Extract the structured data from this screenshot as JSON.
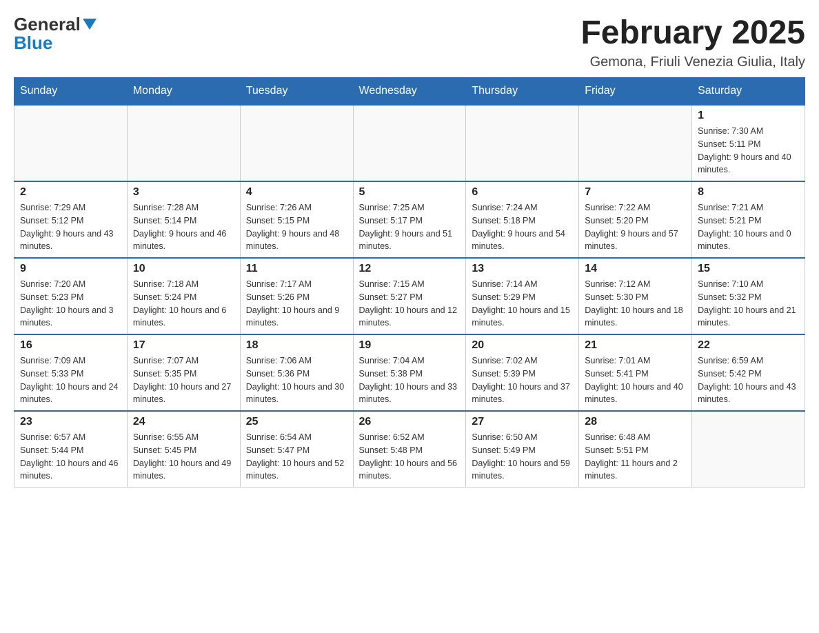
{
  "header": {
    "logo_general": "General",
    "logo_blue": "Blue",
    "title": "February 2025",
    "subtitle": "Gemona, Friuli Venezia Giulia, Italy"
  },
  "days_of_week": [
    "Sunday",
    "Monday",
    "Tuesday",
    "Wednesday",
    "Thursday",
    "Friday",
    "Saturday"
  ],
  "weeks": [
    [
      {
        "day": "",
        "info": ""
      },
      {
        "day": "",
        "info": ""
      },
      {
        "day": "",
        "info": ""
      },
      {
        "day": "",
        "info": ""
      },
      {
        "day": "",
        "info": ""
      },
      {
        "day": "",
        "info": ""
      },
      {
        "day": "1",
        "info": "Sunrise: 7:30 AM\nSunset: 5:11 PM\nDaylight: 9 hours and 40 minutes."
      }
    ],
    [
      {
        "day": "2",
        "info": "Sunrise: 7:29 AM\nSunset: 5:12 PM\nDaylight: 9 hours and 43 minutes."
      },
      {
        "day": "3",
        "info": "Sunrise: 7:28 AM\nSunset: 5:14 PM\nDaylight: 9 hours and 46 minutes."
      },
      {
        "day": "4",
        "info": "Sunrise: 7:26 AM\nSunset: 5:15 PM\nDaylight: 9 hours and 48 minutes."
      },
      {
        "day": "5",
        "info": "Sunrise: 7:25 AM\nSunset: 5:17 PM\nDaylight: 9 hours and 51 minutes."
      },
      {
        "day": "6",
        "info": "Sunrise: 7:24 AM\nSunset: 5:18 PM\nDaylight: 9 hours and 54 minutes."
      },
      {
        "day": "7",
        "info": "Sunrise: 7:22 AM\nSunset: 5:20 PM\nDaylight: 9 hours and 57 minutes."
      },
      {
        "day": "8",
        "info": "Sunrise: 7:21 AM\nSunset: 5:21 PM\nDaylight: 10 hours and 0 minutes."
      }
    ],
    [
      {
        "day": "9",
        "info": "Sunrise: 7:20 AM\nSunset: 5:23 PM\nDaylight: 10 hours and 3 minutes."
      },
      {
        "day": "10",
        "info": "Sunrise: 7:18 AM\nSunset: 5:24 PM\nDaylight: 10 hours and 6 minutes."
      },
      {
        "day": "11",
        "info": "Sunrise: 7:17 AM\nSunset: 5:26 PM\nDaylight: 10 hours and 9 minutes."
      },
      {
        "day": "12",
        "info": "Sunrise: 7:15 AM\nSunset: 5:27 PM\nDaylight: 10 hours and 12 minutes."
      },
      {
        "day": "13",
        "info": "Sunrise: 7:14 AM\nSunset: 5:29 PM\nDaylight: 10 hours and 15 minutes."
      },
      {
        "day": "14",
        "info": "Sunrise: 7:12 AM\nSunset: 5:30 PM\nDaylight: 10 hours and 18 minutes."
      },
      {
        "day": "15",
        "info": "Sunrise: 7:10 AM\nSunset: 5:32 PM\nDaylight: 10 hours and 21 minutes."
      }
    ],
    [
      {
        "day": "16",
        "info": "Sunrise: 7:09 AM\nSunset: 5:33 PM\nDaylight: 10 hours and 24 minutes."
      },
      {
        "day": "17",
        "info": "Sunrise: 7:07 AM\nSunset: 5:35 PM\nDaylight: 10 hours and 27 minutes."
      },
      {
        "day": "18",
        "info": "Sunrise: 7:06 AM\nSunset: 5:36 PM\nDaylight: 10 hours and 30 minutes."
      },
      {
        "day": "19",
        "info": "Sunrise: 7:04 AM\nSunset: 5:38 PM\nDaylight: 10 hours and 33 minutes."
      },
      {
        "day": "20",
        "info": "Sunrise: 7:02 AM\nSunset: 5:39 PM\nDaylight: 10 hours and 37 minutes."
      },
      {
        "day": "21",
        "info": "Sunrise: 7:01 AM\nSunset: 5:41 PM\nDaylight: 10 hours and 40 minutes."
      },
      {
        "day": "22",
        "info": "Sunrise: 6:59 AM\nSunset: 5:42 PM\nDaylight: 10 hours and 43 minutes."
      }
    ],
    [
      {
        "day": "23",
        "info": "Sunrise: 6:57 AM\nSunset: 5:44 PM\nDaylight: 10 hours and 46 minutes."
      },
      {
        "day": "24",
        "info": "Sunrise: 6:55 AM\nSunset: 5:45 PM\nDaylight: 10 hours and 49 minutes."
      },
      {
        "day": "25",
        "info": "Sunrise: 6:54 AM\nSunset: 5:47 PM\nDaylight: 10 hours and 52 minutes."
      },
      {
        "day": "26",
        "info": "Sunrise: 6:52 AM\nSunset: 5:48 PM\nDaylight: 10 hours and 56 minutes."
      },
      {
        "day": "27",
        "info": "Sunrise: 6:50 AM\nSunset: 5:49 PM\nDaylight: 10 hours and 59 minutes."
      },
      {
        "day": "28",
        "info": "Sunrise: 6:48 AM\nSunset: 5:51 PM\nDaylight: 11 hours and 2 minutes."
      },
      {
        "day": "",
        "info": ""
      }
    ]
  ]
}
